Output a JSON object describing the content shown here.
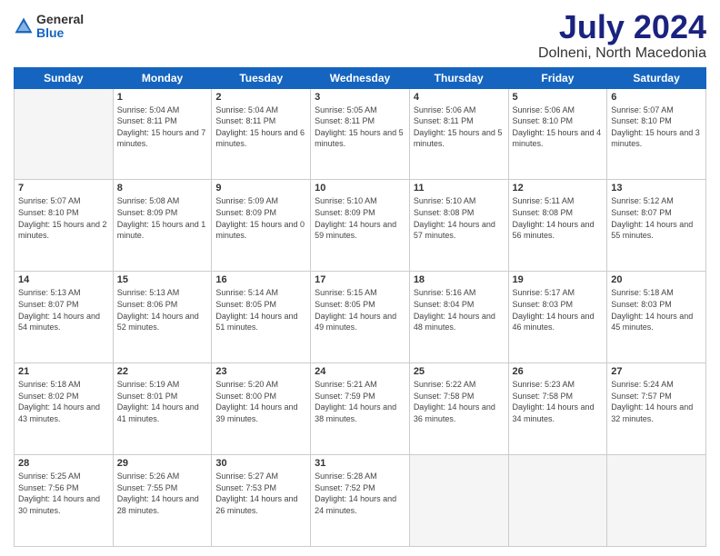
{
  "logo": {
    "general": "General",
    "blue": "Blue"
  },
  "header": {
    "title": "July 2024",
    "location": "Dolneni, North Macedonia"
  },
  "weekdays": [
    "Sunday",
    "Monday",
    "Tuesday",
    "Wednesday",
    "Thursday",
    "Friday",
    "Saturday"
  ],
  "weeks": [
    [
      {
        "day": null
      },
      {
        "day": 1,
        "sunrise": "Sunrise: 5:04 AM",
        "sunset": "Sunset: 8:11 PM",
        "daylight": "Daylight: 15 hours and 7 minutes."
      },
      {
        "day": 2,
        "sunrise": "Sunrise: 5:04 AM",
        "sunset": "Sunset: 8:11 PM",
        "daylight": "Daylight: 15 hours and 6 minutes."
      },
      {
        "day": 3,
        "sunrise": "Sunrise: 5:05 AM",
        "sunset": "Sunset: 8:11 PM",
        "daylight": "Daylight: 15 hours and 5 minutes."
      },
      {
        "day": 4,
        "sunrise": "Sunrise: 5:06 AM",
        "sunset": "Sunset: 8:11 PM",
        "daylight": "Daylight: 15 hours and 5 minutes."
      },
      {
        "day": 5,
        "sunrise": "Sunrise: 5:06 AM",
        "sunset": "Sunset: 8:10 PM",
        "daylight": "Daylight: 15 hours and 4 minutes."
      },
      {
        "day": 6,
        "sunrise": "Sunrise: 5:07 AM",
        "sunset": "Sunset: 8:10 PM",
        "daylight": "Daylight: 15 hours and 3 minutes."
      }
    ],
    [
      {
        "day": 7,
        "sunrise": "Sunrise: 5:07 AM",
        "sunset": "Sunset: 8:10 PM",
        "daylight": "Daylight: 15 hours and 2 minutes."
      },
      {
        "day": 8,
        "sunrise": "Sunrise: 5:08 AM",
        "sunset": "Sunset: 8:09 PM",
        "daylight": "Daylight: 15 hours and 1 minute."
      },
      {
        "day": 9,
        "sunrise": "Sunrise: 5:09 AM",
        "sunset": "Sunset: 8:09 PM",
        "daylight": "Daylight: 15 hours and 0 minutes."
      },
      {
        "day": 10,
        "sunrise": "Sunrise: 5:10 AM",
        "sunset": "Sunset: 8:09 PM",
        "daylight": "Daylight: 14 hours and 59 minutes."
      },
      {
        "day": 11,
        "sunrise": "Sunrise: 5:10 AM",
        "sunset": "Sunset: 8:08 PM",
        "daylight": "Daylight: 14 hours and 57 minutes."
      },
      {
        "day": 12,
        "sunrise": "Sunrise: 5:11 AM",
        "sunset": "Sunset: 8:08 PM",
        "daylight": "Daylight: 14 hours and 56 minutes."
      },
      {
        "day": 13,
        "sunrise": "Sunrise: 5:12 AM",
        "sunset": "Sunset: 8:07 PM",
        "daylight": "Daylight: 14 hours and 55 minutes."
      }
    ],
    [
      {
        "day": 14,
        "sunrise": "Sunrise: 5:13 AM",
        "sunset": "Sunset: 8:07 PM",
        "daylight": "Daylight: 14 hours and 54 minutes."
      },
      {
        "day": 15,
        "sunrise": "Sunrise: 5:13 AM",
        "sunset": "Sunset: 8:06 PM",
        "daylight": "Daylight: 14 hours and 52 minutes."
      },
      {
        "day": 16,
        "sunrise": "Sunrise: 5:14 AM",
        "sunset": "Sunset: 8:05 PM",
        "daylight": "Daylight: 14 hours and 51 minutes."
      },
      {
        "day": 17,
        "sunrise": "Sunrise: 5:15 AM",
        "sunset": "Sunset: 8:05 PM",
        "daylight": "Daylight: 14 hours and 49 minutes."
      },
      {
        "day": 18,
        "sunrise": "Sunrise: 5:16 AM",
        "sunset": "Sunset: 8:04 PM",
        "daylight": "Daylight: 14 hours and 48 minutes."
      },
      {
        "day": 19,
        "sunrise": "Sunrise: 5:17 AM",
        "sunset": "Sunset: 8:03 PM",
        "daylight": "Daylight: 14 hours and 46 minutes."
      },
      {
        "day": 20,
        "sunrise": "Sunrise: 5:18 AM",
        "sunset": "Sunset: 8:03 PM",
        "daylight": "Daylight: 14 hours and 45 minutes."
      }
    ],
    [
      {
        "day": 21,
        "sunrise": "Sunrise: 5:18 AM",
        "sunset": "Sunset: 8:02 PM",
        "daylight": "Daylight: 14 hours and 43 minutes."
      },
      {
        "day": 22,
        "sunrise": "Sunrise: 5:19 AM",
        "sunset": "Sunset: 8:01 PM",
        "daylight": "Daylight: 14 hours and 41 minutes."
      },
      {
        "day": 23,
        "sunrise": "Sunrise: 5:20 AM",
        "sunset": "Sunset: 8:00 PM",
        "daylight": "Daylight: 14 hours and 39 minutes."
      },
      {
        "day": 24,
        "sunrise": "Sunrise: 5:21 AM",
        "sunset": "Sunset: 7:59 PM",
        "daylight": "Daylight: 14 hours and 38 minutes."
      },
      {
        "day": 25,
        "sunrise": "Sunrise: 5:22 AM",
        "sunset": "Sunset: 7:58 PM",
        "daylight": "Daylight: 14 hours and 36 minutes."
      },
      {
        "day": 26,
        "sunrise": "Sunrise: 5:23 AM",
        "sunset": "Sunset: 7:58 PM",
        "daylight": "Daylight: 14 hours and 34 minutes."
      },
      {
        "day": 27,
        "sunrise": "Sunrise: 5:24 AM",
        "sunset": "Sunset: 7:57 PM",
        "daylight": "Daylight: 14 hours and 32 minutes."
      }
    ],
    [
      {
        "day": 28,
        "sunrise": "Sunrise: 5:25 AM",
        "sunset": "Sunset: 7:56 PM",
        "daylight": "Daylight: 14 hours and 30 minutes."
      },
      {
        "day": 29,
        "sunrise": "Sunrise: 5:26 AM",
        "sunset": "Sunset: 7:55 PM",
        "daylight": "Daylight: 14 hours and 28 minutes."
      },
      {
        "day": 30,
        "sunrise": "Sunrise: 5:27 AM",
        "sunset": "Sunset: 7:53 PM",
        "daylight": "Daylight: 14 hours and 26 minutes."
      },
      {
        "day": 31,
        "sunrise": "Sunrise: 5:28 AM",
        "sunset": "Sunset: 7:52 PM",
        "daylight": "Daylight: 14 hours and 24 minutes."
      },
      {
        "day": null
      },
      {
        "day": null
      },
      {
        "day": null
      }
    ]
  ]
}
